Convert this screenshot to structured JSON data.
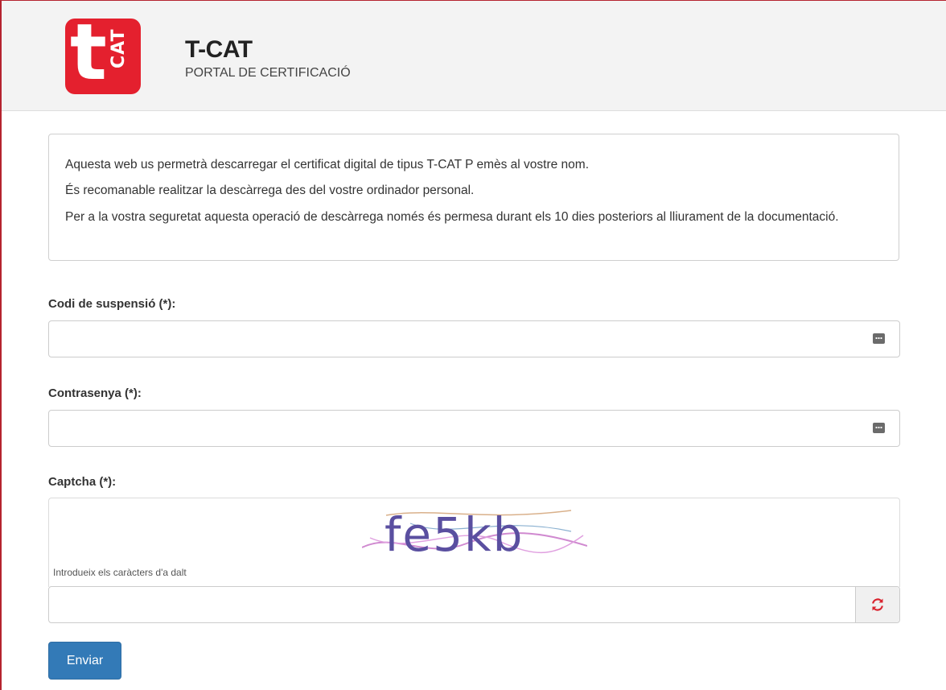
{
  "header": {
    "logo_letter": "t",
    "logo_small": "CAT",
    "title": "T-CAT",
    "subtitle": "PORTAL DE CERTIFICACIÓ"
  },
  "info": {
    "line1": "Aquesta web us permetrà descarregar el certificat digital de tipus T-CAT P emès al vostre nom.",
    "line2": "És recomanable realitzar la descàrrega des del vostre ordinador personal.",
    "line3": "Per a la vostra seguretat aquesta operació de descàrrega només és permesa durant els 10 dies posteriors al lliurament de la documentació."
  },
  "form": {
    "code_label": "Codi de suspensió (*):",
    "code_value": "",
    "password_label": "Contrasenya (*):",
    "password_value": "",
    "captcha_label": "Captcha (*):",
    "captcha_text": "fe5kb",
    "captcha_hint": "Introdueix els caràcters d'a dalt",
    "captcha_value": "",
    "submit_label": "Enviar"
  },
  "icons": {
    "password_manager": "password-manager-icon",
    "refresh": "refresh-icon"
  },
  "colors": {
    "brand_red": "#e4202e",
    "primary_button": "#337ab7",
    "refresh_icon": "#d9232e"
  }
}
